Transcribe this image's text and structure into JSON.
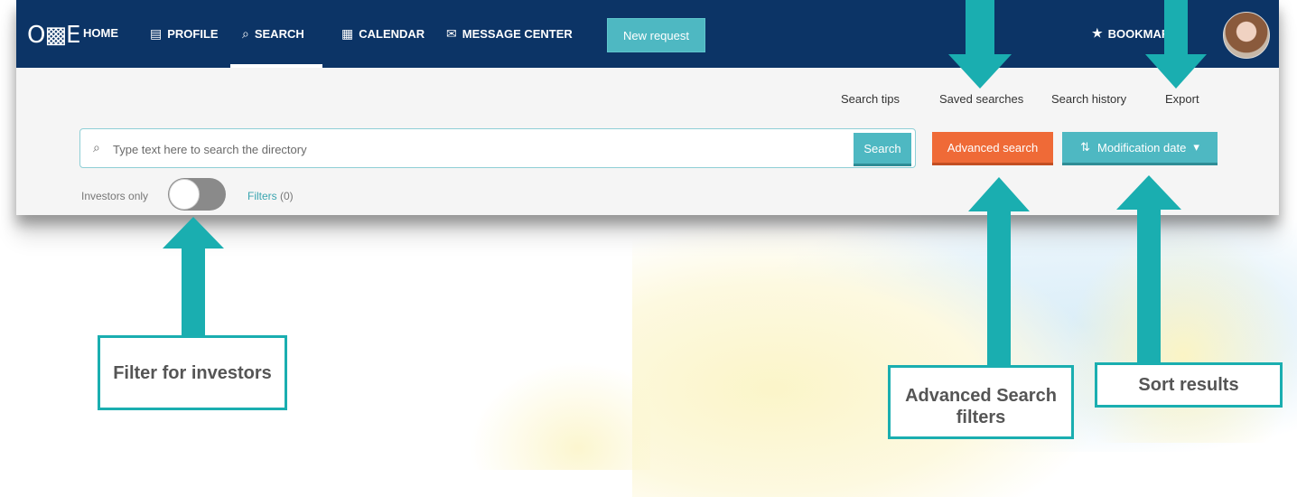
{
  "nav": {
    "logo": "O▩E",
    "items": [
      {
        "label": "HOME",
        "icon": "home"
      },
      {
        "label": "PROFILE",
        "icon": "profile-icon"
      },
      {
        "label": "SEARCH",
        "icon": "search-icon"
      },
      {
        "label": "CALENDAR",
        "icon": "calendar-icon"
      },
      {
        "label": "MESSAGE CENTER",
        "icon": "mail-icon"
      }
    ],
    "active_item": "SEARCH",
    "new_request_label": "New request",
    "bookmarks_label": "BOOKMARKS"
  },
  "toplinks": {
    "search_tips": "Search tips",
    "saved_searches": "Saved searches",
    "search_history": "Search history",
    "export": "Export"
  },
  "search": {
    "placeholder": "Type text here to search the directory",
    "button_label": "Search",
    "advanced_label": "Advanced search",
    "sort_label": "Modification date",
    "sort_caret": "▾"
  },
  "filters": {
    "investors_only_label": "Investors only",
    "investors_only_on": false,
    "filters_label": "Filters",
    "filters_count": "(0)"
  },
  "callouts": {
    "investors": "Filter for investors",
    "advanced": "Advanced Search filters",
    "sort": "Sort results"
  },
  "colors": {
    "nav_bg": "#0c3466",
    "accent_teal": "#4eb8c2",
    "accent_orange": "#ef6a37",
    "annotation_teal": "#1aaeb0"
  }
}
